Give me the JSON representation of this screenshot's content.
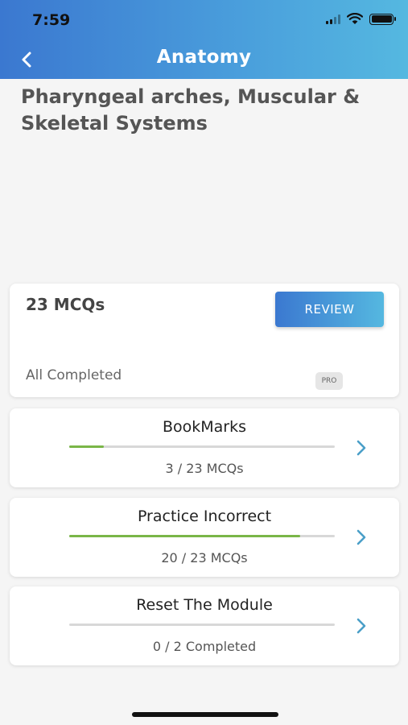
{
  "status_bar": {
    "time": "7:59"
  },
  "nav": {
    "title": "Anatomy"
  },
  "module": {
    "title": "Pharyngeal arches, Muscular & Skeletal Systems"
  },
  "summary": {
    "mcq_count": "23 MCQs",
    "review_label": "REVIEW",
    "status": "All Completed",
    "badge": "PRO"
  },
  "actions": [
    {
      "title": "BookMarks",
      "subtitle": "3 / 23 MCQs",
      "progress": 0.13
    },
    {
      "title": "Practice Incorrect",
      "subtitle": "20 / 23 MCQs",
      "progress": 0.87
    },
    {
      "title": "Reset The Module",
      "subtitle": "0 / 2 Completed",
      "progress": 0
    }
  ],
  "colors": {
    "header_start": "#3b78d0",
    "header_end": "#55b8e0",
    "progress": "#7ab648",
    "chevron": "#4a9fc8"
  }
}
